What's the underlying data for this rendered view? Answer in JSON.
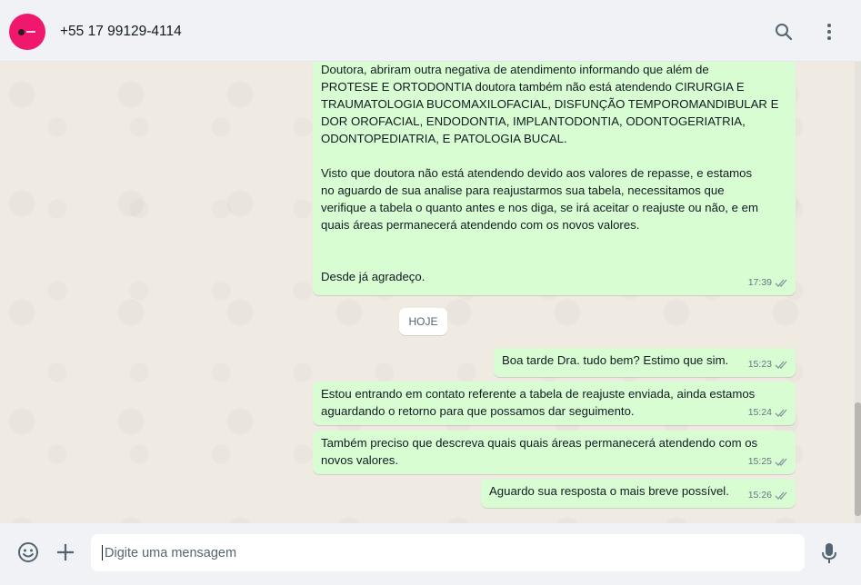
{
  "header": {
    "contact": "+55 17 99129-4114",
    "icons": {
      "search": "search-icon",
      "menu": "menu-icon"
    }
  },
  "chat": {
    "messages": [
      {
        "text": "Doutora, abriram outra negativa de atendimento informando que além de\nPROTESE E ORTODONTIA doutora também não está atendendo CIRURGIA E\nTRAUMATOLOGIA BUCOMAXILOFACIAL, DISFUNÇÃO TEMPOROMANDIBULAR E\nDOR OROFACIAL, ENDODONTIA, IMPLANTODONTIA, ODONTOGERIATRIA,\nODONTOPEDIATRIA, E PATOLOGIA BUCAL.\n\nVisto que doutora não está atendendo devido aos valores de repasse, e estamos\nno aguardo de sua analise para reajustarmos sua tabela, necessitamos que\nverifique a tabela o quanto antes e nos diga, se irá aceitar o reajuste ou não, e em\nquais áreas permanecerá atendendo com os novos valores.\n\n\nDesde já agradeço.",
        "time": "17:39"
      },
      {
        "text": "Boa tarde Dra. tudo bem? Estimo que sim.",
        "time": "15:23"
      },
      {
        "text": "Estou entrando em contato referente a tabela de reajuste enviada, ainda estamos\naguardando o retorno para que possamos dar seguimento.",
        "time": "15:24"
      },
      {
        "text": "Também preciso que descreva quais quais áreas permanecerá atendendo com os\nnovos valores.",
        "time": "15:25"
      },
      {
        "text": "Aguardo sua resposta o mais breve possível.",
        "time": "15:26"
      }
    ],
    "date_divider": "HOJE"
  },
  "footer": {
    "placeholder": "Digite uma mensagem",
    "icons": {
      "emoji": "emoji-icon",
      "attach": "plus-icon",
      "mic": "mic-icon"
    }
  },
  "colors": {
    "outgoing_bubble": "#d9fdd3",
    "tick": "#8696a0",
    "avatar": "#f0186d"
  }
}
